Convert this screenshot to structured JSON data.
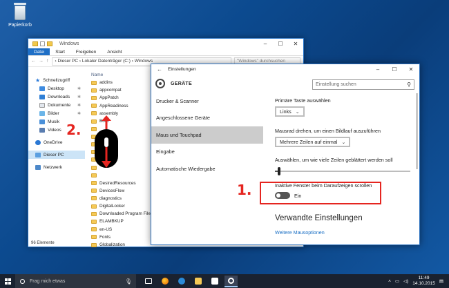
{
  "desktop": {
    "recycle_bin_label": "Papierkorb"
  },
  "explorer": {
    "title": "Windows",
    "tabs": [
      "Datei",
      "Start",
      "Freigeben",
      "Ansicht"
    ],
    "address_path": "› Dieser PC › Lokaler Datenträger (C:) › Windows",
    "search_placeholder": "\"Windows\" durchsuchen",
    "column_header": "Name",
    "nav": {
      "quick_access": "Schnellzugriff",
      "desktop": "Desktop",
      "downloads": "Downloads",
      "documents": "Dokumente",
      "pictures": "Bilder",
      "music": "Musik",
      "videos": "Videos",
      "onedrive": "OneDrive",
      "this_pc": "Dieser PC",
      "network": "Netzwerk"
    },
    "folders": [
      "addins",
      "appcompat",
      "AppPatch",
      "AppReadiness",
      "assembly",
      "Boot",
      "",
      "",
      "",
      "",
      "",
      "",
      "",
      "DesiredResources",
      "DevicesFlow",
      "diagnostics",
      "DigitalLocker",
      "Downloaded Program Files",
      "ELAMBKUP",
      "en-US",
      "Fonts",
      "Globalization"
    ],
    "status": "96 Elemente"
  },
  "settings": {
    "window_title": "Einstellungen",
    "section_title": "GERÄTE",
    "search_placeholder": "Einstellung suchen",
    "menu": [
      {
        "label": "Drucker & Scanner",
        "active": false
      },
      {
        "label": "Angeschlossene Geräte",
        "active": false
      },
      {
        "label": "Maus und Touchpad",
        "active": true
      },
      {
        "label": "Eingabe",
        "active": false
      },
      {
        "label": "Automatische Wiedergabe",
        "active": false
      }
    ],
    "primary_button_label": "Primäre Taste auswählen",
    "primary_button_value": "Links",
    "wheel_label": "Mausrad drehen, um einen Bildlauf auszuführen",
    "wheel_value": "Mehrere Zeilen auf einmal",
    "lines_label": "Auswählen, um wie viele Zeilen geblättert werden soll",
    "lines_slider_fraction": 0.02,
    "inactive_scroll_label": "Inaktive Fenster beim Daraufzeigen scrollen",
    "inactive_scroll_state": "Ein",
    "related_title": "Verwandte Einstellungen",
    "related_link": "Weitere Mausoptionen"
  },
  "annotations": {
    "step1": "1.",
    "step2": "2."
  },
  "taskbar": {
    "search_placeholder": "Frag mich etwas",
    "time": "11:49",
    "date": "14.10.2015"
  },
  "colors": {
    "accent": "#1f6fc6",
    "annotation_red": "#e52520",
    "taskbar": "#1a2230"
  }
}
